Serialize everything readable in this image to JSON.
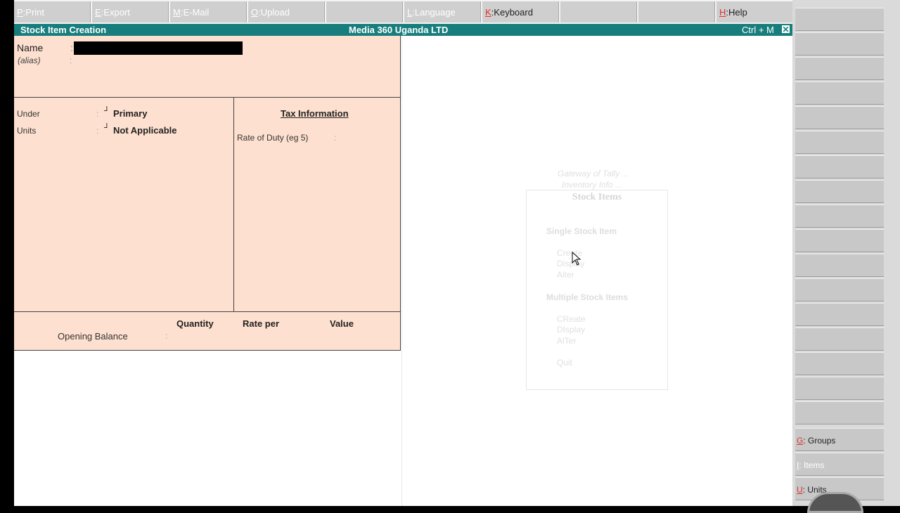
{
  "toolbar": {
    "buttons": [
      {
        "key": "P",
        "label": "Print",
        "active": false
      },
      {
        "key": "E",
        "label": "Export",
        "active": false
      },
      {
        "key": "M",
        "label": "E-Mail",
        "active": false
      },
      {
        "key": "O",
        "label": "Upload",
        "active": false
      },
      {
        "key": "",
        "label": "",
        "active": false
      },
      {
        "key": "L",
        "label": "Language",
        "active": false
      },
      {
        "key": "K",
        "label": "Keyboard",
        "active": true
      },
      {
        "key": "",
        "label": "",
        "active": false
      },
      {
        "key": "",
        "label": "",
        "active": false
      },
      {
        "key": "H",
        "label": "Help",
        "active": true
      }
    ]
  },
  "title_bar": {
    "screen": "Stock Item Creation",
    "company": "Media 360 Uganda LTD",
    "shortcut": "Ctrl + M",
    "close_glyph": "✕"
  },
  "form": {
    "name_label": "Name",
    "name_colon": ":",
    "alias_label": "(alias)",
    "alias_colon": ":",
    "under_label": "Under",
    "under_colon": ":",
    "under_mark": "┘",
    "under_value": "Primary",
    "units_label": "Units",
    "units_colon": ":",
    "units_mark": "┘",
    "units_value": "Not Applicable",
    "tax_title": "Tax Information",
    "rate_label": "Rate of Duty (eg 5)",
    "rate_colon": ":",
    "headers": {
      "quantity": "Quantity",
      "rate": "Rate per",
      "value": "Value"
    },
    "opening_balance_label": "Opening Balance",
    "opening_colon": ":"
  },
  "background_menu": {
    "caption_1": "Gateway of Tally ...",
    "caption_2": "Inventory Info ...",
    "title": "Stock Items",
    "section_1": "Single Stock Item",
    "single_items": [
      "Create",
      "Display",
      "Alter"
    ],
    "section_2": "Multiple Stock Items",
    "multiple_items": [
      "CReate",
      "DIsplay",
      "AlTer"
    ],
    "quit": "Quit"
  },
  "sidebar": {
    "groups": {
      "key": "G",
      "label": "Groups"
    },
    "items": {
      "key": "I",
      "label": "Items"
    },
    "units": {
      "key": "U",
      "label": "Units"
    }
  },
  "colors": {
    "title_bar": "#187e7d",
    "form_bg": "#fde0cf",
    "hotkey": "#e0332e"
  }
}
